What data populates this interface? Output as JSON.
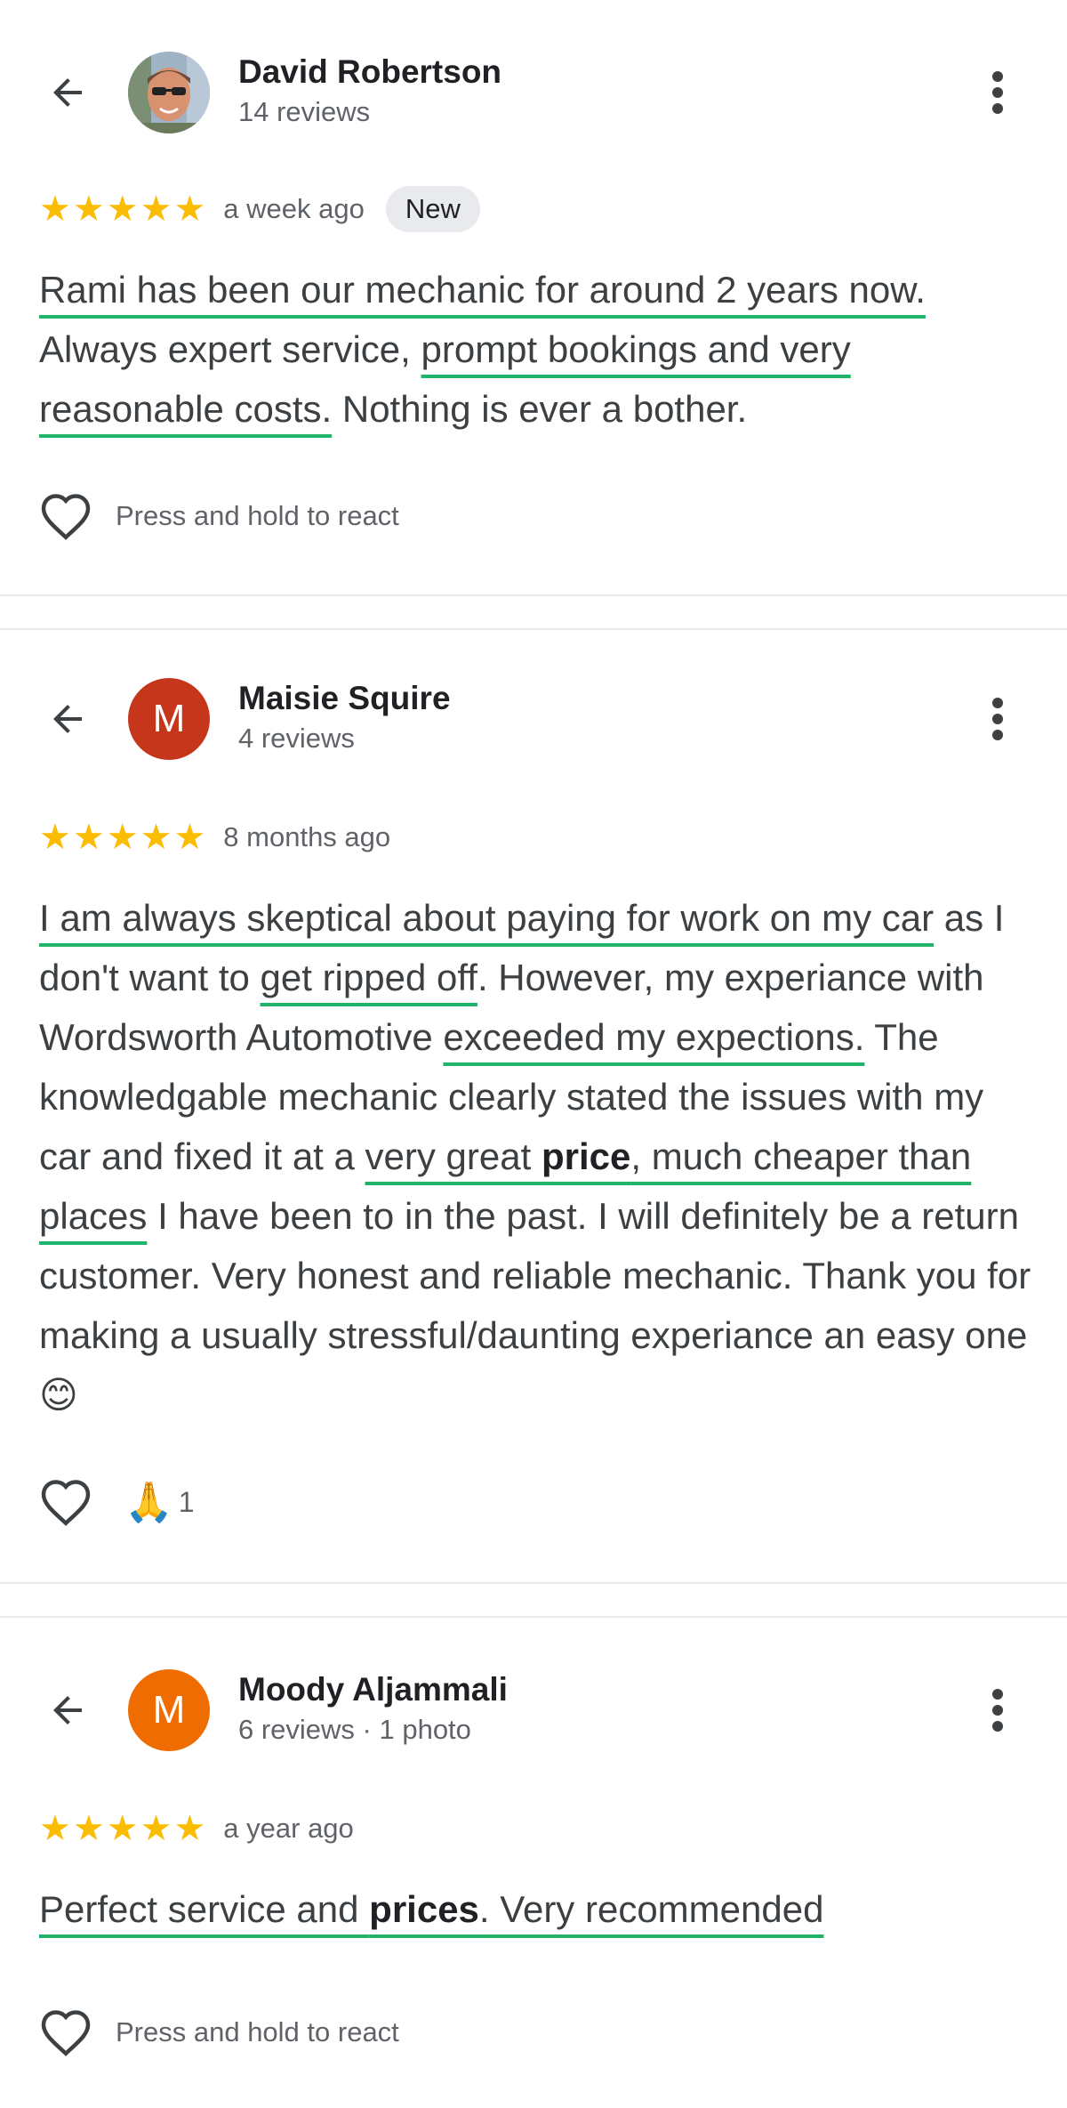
{
  "reviews": [
    {
      "name": "David Robertson",
      "meta": "14 reviews",
      "avatar": "photo",
      "rating": 5,
      "time_ago": "a week ago",
      "badge": "New",
      "text": {
        "s1": "Rami has been our mechanic for around 2 years now.",
        "s2": " Always expert service, ",
        "s3": "prompt bookings and very reasonable costs.",
        "s4": " Nothing is ever a bother."
      },
      "reaction_label": "Press and hold to react"
    },
    {
      "name": "Maisie Squire",
      "meta": "4 reviews",
      "avatar_letter": "M",
      "avatar_color": "#c5361b",
      "rating": 5,
      "time_ago": "8 months ago",
      "text": {
        "s1": "I am always skeptical about paying for work on my car",
        "s2": " as I don't want to ",
        "s3": "get ripped off",
        "s4": ". However, my experiance with Wordsworth Automotive ",
        "s5": "exceeded my expections.",
        "s6": " The knowledgable mechanic clearly stated the issues with my car and fixed it at a ",
        "s7": "very great ",
        "s8": "price",
        "s9": ", much cheaper than places",
        "s10": " I have been to in the past. I will definitely be a return customer. Very honest and reliable mechanic. Thank you for making a usually stressful/daunting experiance an easy one ",
        "emoji": "😊"
      },
      "reaction_emoji": "🙏",
      "reaction_count": "1"
    },
    {
      "name": "Moody Aljammali",
      "meta": "6 reviews · 1 photo",
      "avatar_letter": "M",
      "avatar_color": "#ef6c00",
      "rating": 5,
      "time_ago": "a year ago",
      "text": {
        "s1": "Perfect service and ",
        "s2": "prices",
        "s3": ". Very recommended"
      },
      "reaction_label": "Press and hold to react"
    }
  ],
  "colors": {
    "star": "#fbbc04",
    "underline": "#21b36a",
    "muted": "#5f6368"
  },
  "icons": [
    "back-arrow-icon",
    "more-vert-icon",
    "star-icon",
    "heart-icon"
  ]
}
